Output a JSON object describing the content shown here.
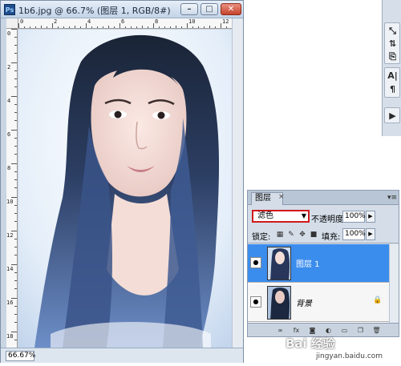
{
  "document": {
    "title": "1b6.jpg @ 66.7% (图层 1, RGB/8#)",
    "app_icon": "Ps",
    "zoom": "66.67%",
    "window_buttons": {
      "minimize": "–",
      "maximize": "□",
      "close": "✕"
    },
    "ruler_h": [
      "0",
      "2",
      "4",
      "6",
      "8",
      "10",
      "12"
    ],
    "ruler_v": [
      "0",
      "2",
      "4",
      "6",
      "8",
      "10",
      "12",
      "14",
      "16",
      "18"
    ]
  },
  "tools": {
    "group1": [
      "⤡",
      "⇅",
      "⎘"
    ],
    "group2": [
      "A|",
      "¶"
    ],
    "group3": [
      "▶"
    ]
  },
  "layers_panel": {
    "tab_label": "图层",
    "tab_close": "×",
    "menu_icon": "▾≡",
    "blend_mode": "滤色",
    "opacity_label": "不透明度:",
    "opacity_value": "100%",
    "lock_label": "锁定:",
    "fill_label": "填充:",
    "fill_value": "100%",
    "layers": [
      {
        "name": "图层 1",
        "selected": true,
        "visible": true
      },
      {
        "name": "背景",
        "selected": false,
        "visible": true,
        "locked": true
      }
    ],
    "selected_color": "#3b8ded",
    "highlight_color": "#d0181c"
  },
  "watermark": {
    "brand": "Bai 经验",
    "url": "jingyan.baidu.com"
  }
}
